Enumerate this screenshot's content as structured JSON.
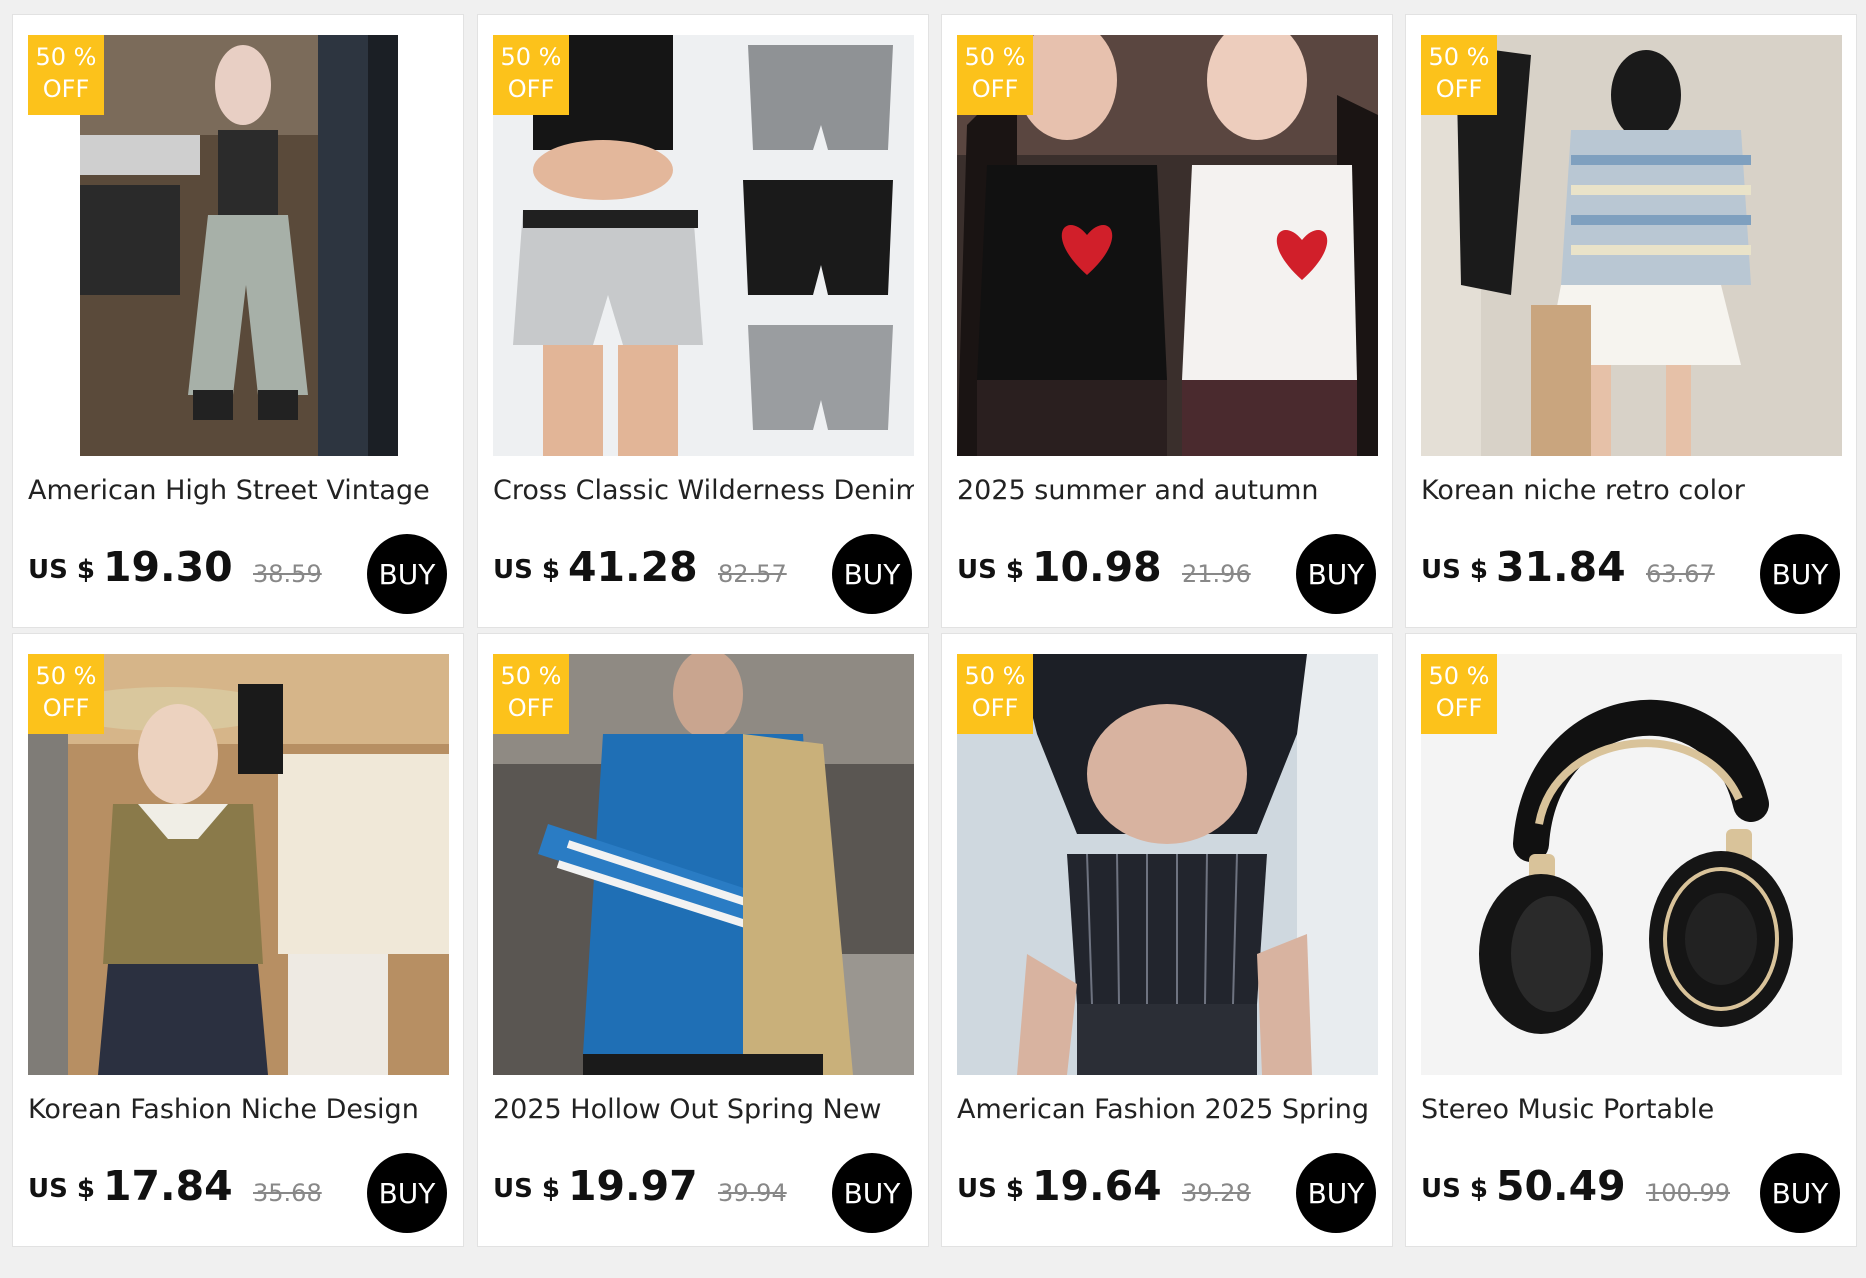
{
  "products": [
    {
      "badge_pct": "50 %",
      "badge_off": "OFF",
      "title": "American High Street Vintage",
      "currency": "US $",
      "price": "19.30",
      "original_price": "38.59",
      "buy_label": "BUY",
      "image": "woman-selfie-baggy-jeans-photo"
    },
    {
      "badge_pct": "50 %",
      "badge_off": "OFF",
      "title": "Cross Classic Wilderness Denim",
      "currency": "US $",
      "price": "41.28",
      "original_price": "82.57",
      "buy_label": "BUY",
      "image": "denim-shorts-photo"
    },
    {
      "badge_pct": "50 %",
      "badge_off": "OFF",
      "title": "2025 summer and autumn",
      "currency": "US $",
      "price": "10.98",
      "original_price": "21.96",
      "buy_label": "BUY",
      "image": "i-heart-me-tank-tops-photo"
    },
    {
      "badge_pct": "50 %",
      "badge_off": "OFF",
      "title": "Korean niche retro color",
      "currency": "US $",
      "price": "31.84",
      "original_price": "63.67",
      "buy_label": "BUY",
      "image": "striped-sweater-skirt-photo"
    },
    {
      "badge_pct": "50 %",
      "badge_off": "OFF",
      "title": "Korean Fashion Niche Design",
      "currency": "US $",
      "price": "17.84",
      "original_price": "35.68",
      "buy_label": "BUY",
      "image": "knit-polo-sun-hat-photo"
    },
    {
      "badge_pct": "50 %",
      "badge_off": "OFF",
      "title": "2025 Hollow Out Spring New",
      "currency": "US $",
      "price": "19.97",
      "original_price": "39.94",
      "buy_label": "BUY",
      "image": "blue-mesh-cardigan-photo"
    },
    {
      "badge_pct": "50 %",
      "badge_off": "OFF",
      "title": "American Fashion 2025 Spring",
      "currency": "US $",
      "price": "19.64",
      "original_price": "39.28",
      "buy_label": "BUY",
      "image": "pinstripe-corset-top-photo"
    },
    {
      "badge_pct": "50 %",
      "badge_off": "OFF",
      "title": "Stereo Music Portable",
      "currency": "US $",
      "price": "50.49",
      "original_price": "100.99",
      "buy_label": "BUY",
      "image": "black-gold-headphones-photo"
    }
  ],
  "colors": {
    "badge": "#fcc21b",
    "buy_button": "#000000",
    "page_bg": "#f0f0f0"
  }
}
